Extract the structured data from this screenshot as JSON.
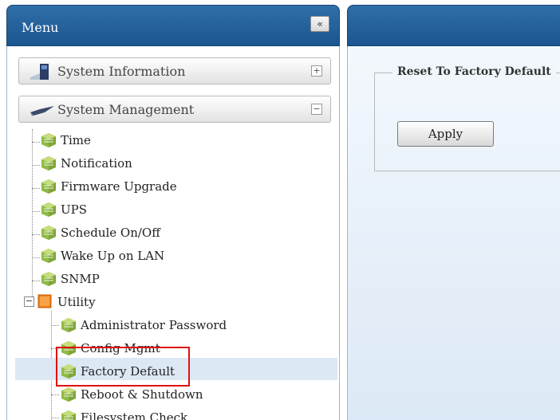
{
  "menu": {
    "title": "Menu",
    "collapse_icon": "«",
    "sections": [
      {
        "label": "System Information",
        "toggle": "+",
        "icon": "info-computer-icon"
      },
      {
        "label": "System Management",
        "toggle": "−",
        "icon": "management-tools-icon"
      }
    ],
    "items": [
      {
        "label": "Time"
      },
      {
        "label": "Notification"
      },
      {
        "label": "Firmware Upgrade"
      },
      {
        "label": "UPS"
      },
      {
        "label": "Schedule On/Off"
      },
      {
        "label": "Wake Up on LAN"
      },
      {
        "label": "SNMP"
      }
    ],
    "utility": {
      "label": "Utility",
      "expander": "−",
      "children": [
        {
          "label": "Administrator Password"
        },
        {
          "label": "Config Mgmt"
        },
        {
          "label": "Factory Default"
        },
        {
          "label": "Reboot & Shutdown"
        },
        {
          "label": "Filesystem Check"
        }
      ]
    },
    "selected": "Factory Default"
  },
  "content": {
    "section_title": "Reset To Factory Default",
    "apply_label": "Apply"
  },
  "colors": {
    "header_blue": "#1c5590",
    "highlight_red": "#e01010",
    "selected_bg": "#dde8f5"
  }
}
